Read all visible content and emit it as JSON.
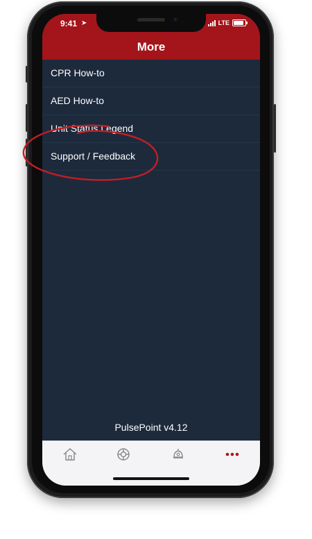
{
  "status_bar": {
    "time": "9:41",
    "network": "LTE"
  },
  "header": {
    "title": "More"
  },
  "menu": {
    "items": [
      {
        "label": "CPR How-to"
      },
      {
        "label": "AED How-to"
      },
      {
        "label": "Unit Status Legend"
      },
      {
        "label": "Support / Feedback"
      }
    ]
  },
  "footer": {
    "version": "PulsePoint v4.12"
  },
  "tabbar": {
    "tabs": [
      {
        "icon": "home-icon"
      },
      {
        "icon": "lifebuoy-icon"
      },
      {
        "icon": "alert-bell-icon"
      },
      {
        "icon": "more-dots-icon",
        "active": true
      }
    ]
  },
  "colors": {
    "header_red": "#a3151a",
    "background_navy": "#1d2a3c",
    "annotation_red": "#c41e24"
  }
}
